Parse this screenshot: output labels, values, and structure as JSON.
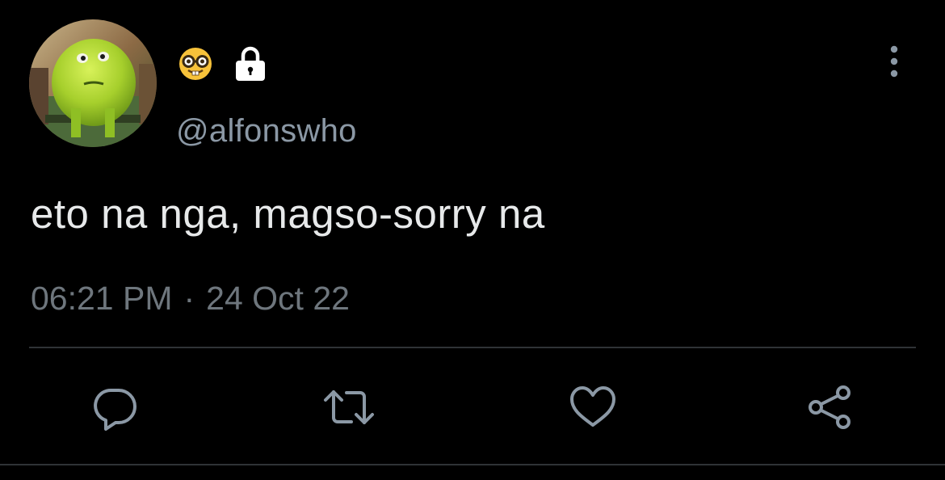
{
  "tweet": {
    "handle": "@alfonswho",
    "text": "eto na nga, magso-sorry na",
    "time": "06:21 PM",
    "separator": "·",
    "date": "24 Oct 22"
  },
  "icons": {
    "name_emoji": "nerd-face-emoji",
    "protected": "lock-icon",
    "more": "more-vertical-icon",
    "reply": "reply-icon",
    "retweet": "retweet-icon",
    "like": "heart-icon",
    "share": "share-icon"
  },
  "colors": {
    "background": "#000000",
    "text": "#e7e9ea",
    "secondary": "#8b98a5",
    "muted": "#6e767d",
    "divider": "#2f3336",
    "action_icon": "#8b98a5"
  }
}
